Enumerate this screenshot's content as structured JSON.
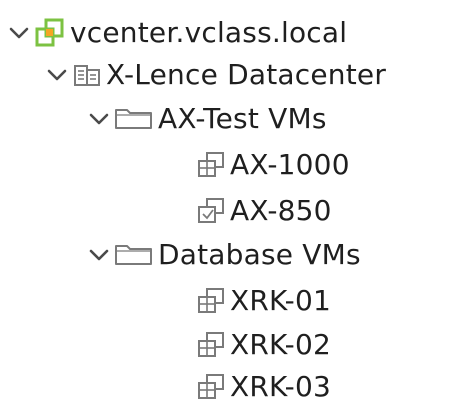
{
  "tree": {
    "vcenter": {
      "label": "vcenter.vclass.local",
      "icon": "vcenter-icon"
    },
    "datacenter": {
      "label": "X-Lence Datacenter",
      "icon": "datacenter-icon"
    },
    "folders": [
      {
        "label": "AX-Test VMs",
        "icon": "folder-icon",
        "vms": [
          {
            "label": "AX-1000",
            "icon": "vm-icon"
          },
          {
            "label": "AX-850",
            "icon": "vm-template-icon"
          }
        ]
      },
      {
        "label": "Database VMs",
        "icon": "folder-icon",
        "vms": [
          {
            "label": "XRK-01",
            "icon": "vm-icon"
          },
          {
            "label": "XRK-02",
            "icon": "vm-icon"
          },
          {
            "label": "XRK-03",
            "icon": "vm-icon"
          }
        ]
      }
    ]
  },
  "colors": {
    "chevron": "#4a4a4a",
    "vcenter_green": "#7cc242",
    "vcenter_orange": "#f5a623",
    "icon_gray": "#7a7a7a",
    "text": "#1f1f1f"
  }
}
